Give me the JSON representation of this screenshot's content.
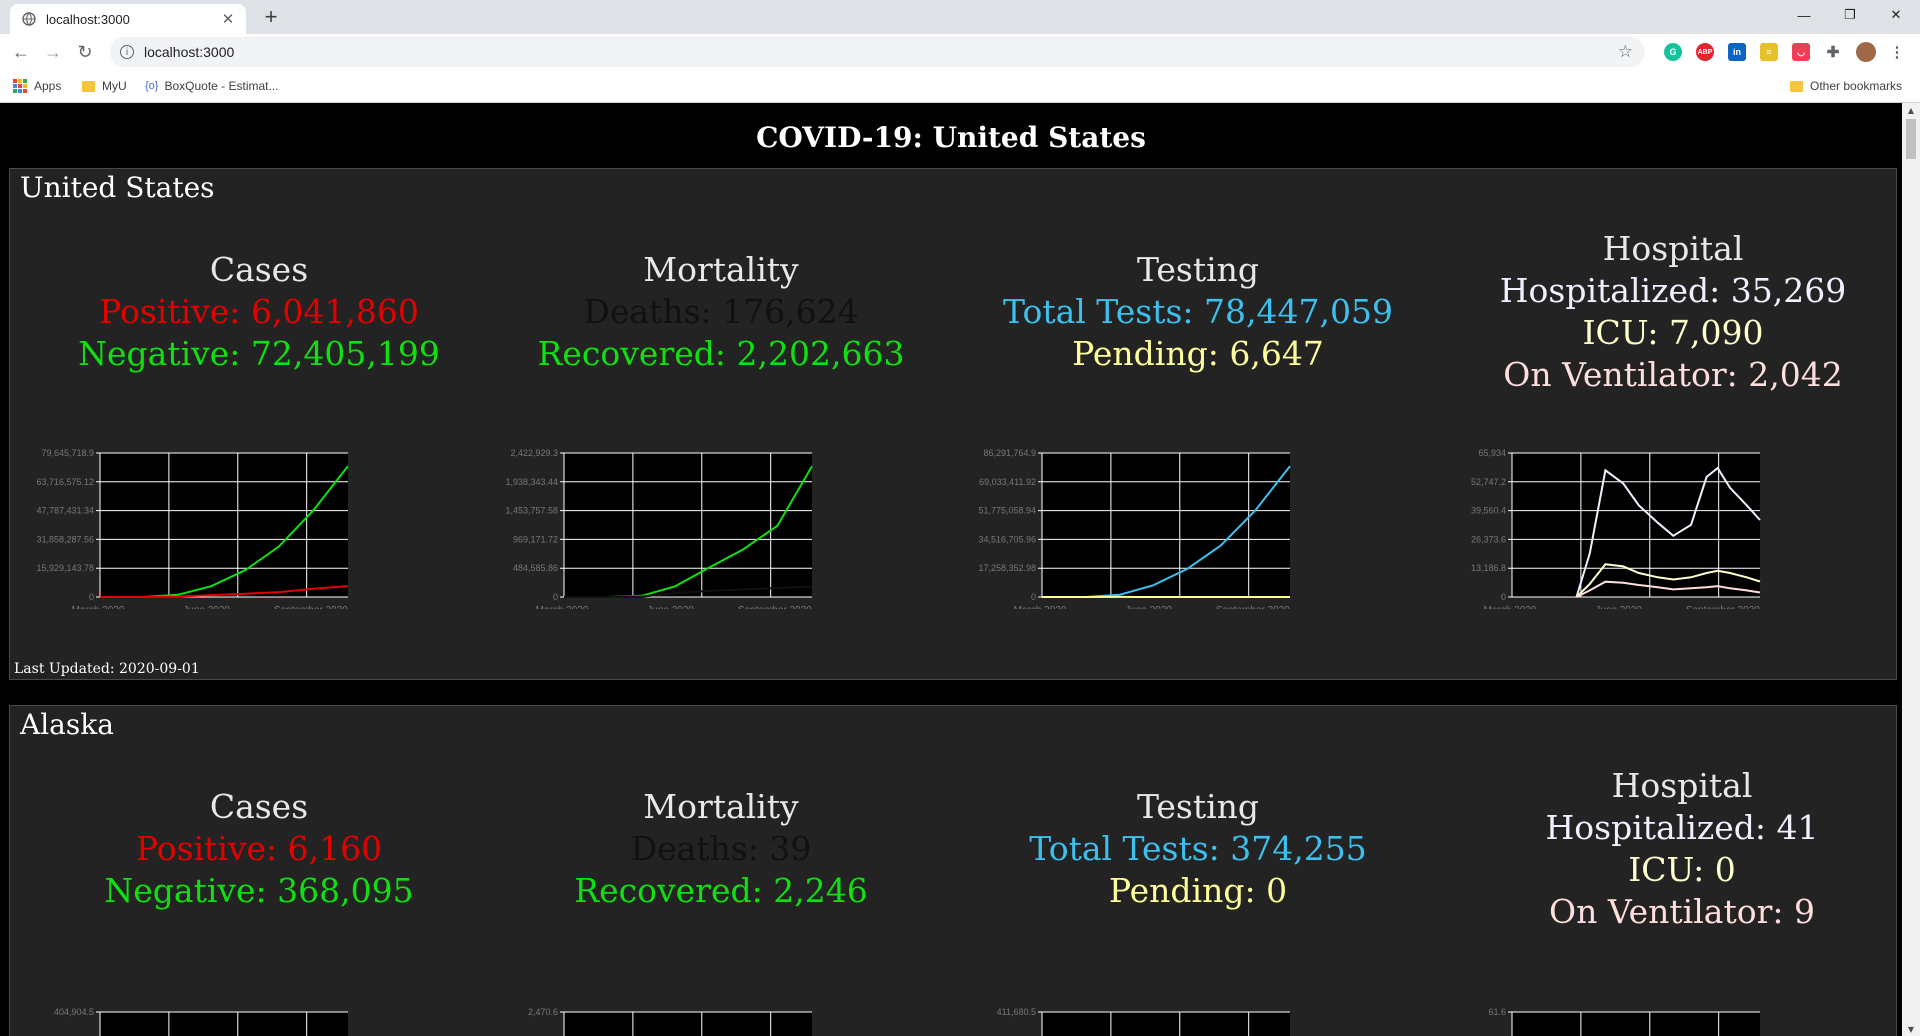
{
  "browser": {
    "tab_title": "localhost:3000",
    "url": "localhost:3000",
    "bookmarks": [
      {
        "label": "Apps",
        "icon": "apps-grid-icon"
      },
      {
        "label": "MyU",
        "icon": "folder-icon"
      },
      {
        "label": "BoxQuote - Estimat...",
        "icon": "boxquote-icon"
      }
    ],
    "other_bookmarks": "Other bookmarks",
    "extensions": [
      "grammarly-icon",
      "adblock-plus-icon",
      "linkedin-icon",
      "extension-icon",
      "pocket-icon",
      "puzzle-extensions-icon",
      "profile-avatar"
    ]
  },
  "page": {
    "title": "COVID-19: United States",
    "colors": {
      "positive": "#e50000",
      "negative": "#10e010",
      "deaths": "#111111",
      "tests": "#3cc0f0",
      "pending": "#ffff99",
      "hospital": "#f0f0ff",
      "icu": "#ffffcc",
      "ventilator": "#ffdede"
    }
  },
  "states": [
    {
      "name": "United States",
      "cases": {
        "head": "Cases",
        "positive_label": "Positive:",
        "positive": "6,041,860",
        "negative_label": "Negative:",
        "negative": "72,405,199"
      },
      "mortality": {
        "head": "Mortality",
        "deaths_label": "Deaths:",
        "deaths": "176,624",
        "recovered_label": "Recovered:",
        "recovered": "2,202,663"
      },
      "testing": {
        "head": "Testing",
        "total_label": "Total Tests:",
        "total": "78,447,059",
        "pending_label": "Pending:",
        "pending": "6,647"
      },
      "hospital": {
        "head": "Hospital",
        "hosp_label": "Hospitalized:",
        "hosp": "35,269",
        "icu_label": "ICU:",
        "icu": "7,090",
        "vent_label": "On Ventilator:",
        "vent": "2,042"
      },
      "last_updated": "Last Updated: 2020-09-01"
    },
    {
      "name": "Alaska",
      "cases": {
        "head": "Cases",
        "positive_label": "Positive:",
        "positive": "6,160",
        "negative_label": "Negative:",
        "negative": "368,095"
      },
      "mortality": {
        "head": "Mortality",
        "deaths_label": "Deaths:",
        "deaths": "39",
        "recovered_label": "Recovered:",
        "recovered": "2,246"
      },
      "testing": {
        "head": "Testing",
        "total_label": "Total Tests:",
        "total": "374,255",
        "pending_label": "Pending:",
        "pending": "0"
      },
      "hospital": {
        "head": "Hospital",
        "hosp_label": "Hospitalized:",
        "hosp": "41",
        "icu_label": "ICU:",
        "icu": "0",
        "vent_label": "On Ventilator:",
        "vent": "9"
      },
      "last_updated": ""
    }
  ],
  "chart_data": [
    {
      "type": "line",
      "panel": "United States - Cases",
      "xlabels": [
        "March 2020",
        "June 2020",
        "September 2020"
      ],
      "yticks": [
        "79,645,718.9",
        "63,716,575.12",
        "47,787,431.34",
        "31,858,287.56",
        "15,929,143.78",
        "0"
      ],
      "ylim": [
        0,
        79645718.9
      ],
      "x": [
        "2020-01-22",
        "2020-03-01",
        "2020-04-01",
        "2020-05-01",
        "2020-06-01",
        "2020-07-01",
        "2020-08-01",
        "2020-09-01"
      ],
      "series": [
        {
          "name": "Negative",
          "color": "#10e010",
          "values": [
            0,
            10000,
            1200000,
            6000000,
            15000000,
            28000000,
            48000000,
            72405199
          ]
        },
        {
          "name": "Positive",
          "color": "#e50000",
          "values": [
            0,
            100,
            200000,
            1070000,
            1800000,
            2700000,
            4600000,
            6041860
          ]
        }
      ]
    },
    {
      "type": "line",
      "panel": "United States - Mortality",
      "xlabels": [
        "March 2020",
        "June 2020",
        "September 2020"
      ],
      "yticks": [
        "2,422,929.3",
        "1,938,343.44",
        "1,453,757.58",
        "969,171.72",
        "484,585.86",
        "0"
      ],
      "ylim": [
        0,
        2422929.3
      ],
      "x": [
        "2020-01-22",
        "2020-03-01",
        "2020-04-01",
        "2020-05-01",
        "2020-06-01",
        "2020-07-01",
        "2020-08-01",
        "2020-09-01"
      ],
      "series": [
        {
          "name": "Recovered",
          "color": "#10e010",
          "values": [
            0,
            0,
            20000,
            180000,
            500000,
            800000,
            1200000,
            2202663
          ]
        },
        {
          "name": "Deaths",
          "color": "#111111",
          "values": [
            0,
            0,
            6000,
            62000,
            104000,
            127000,
            152000,
            176624
          ]
        }
      ]
    },
    {
      "type": "line",
      "panel": "United States - Testing",
      "xlabels": [
        "March 2020",
        "June 2020",
        "September 2020"
      ],
      "yticks": [
        "86,291,764.9",
        "69,033,411.92",
        "51,775,058.94",
        "34,516,705.96",
        "17,258,352.98",
        "0"
      ],
      "ylim": [
        0,
        86291764.9
      ],
      "x": [
        "2020-01-22",
        "2020-03-01",
        "2020-04-01",
        "2020-05-01",
        "2020-06-01",
        "2020-07-01",
        "2020-08-01",
        "2020-09-01"
      ],
      "series": [
        {
          "name": "Total Tests",
          "color": "#3cc0f0",
          "values": [
            0,
            10000,
            1400000,
            7000000,
            17000000,
            31000000,
            52000000,
            78447059
          ]
        },
        {
          "name": "Pending",
          "color": "#ffff99",
          "values": [
            0,
            0,
            60000,
            5000,
            3000,
            2000,
            8000,
            6647
          ]
        }
      ]
    },
    {
      "type": "line",
      "panel": "United States - Hospital",
      "xlabels": [
        "March 2020",
        "June 2020",
        "September 2020"
      ],
      "yticks": [
        "65,934",
        "52,747.2",
        "39,560.4",
        "26,373.6",
        "13,186.8",
        "0"
      ],
      "ylim": [
        0,
        65934
      ],
      "x": [
        "2020-03-20",
        "2020-04-01",
        "2020-04-15",
        "2020-05-01",
        "2020-05-15",
        "2020-06-01",
        "2020-06-15",
        "2020-07-01",
        "2020-07-15",
        "2020-07-25",
        "2020-08-05",
        "2020-08-20",
        "2020-09-01"
      ],
      "series": [
        {
          "name": "Hospitalized",
          "color": "#f0f0ff",
          "values": [
            0,
            20000,
            58000,
            52000,
            42000,
            34000,
            28000,
            33000,
            55000,
            59000,
            50000,
            42000,
            35269
          ]
        },
        {
          "name": "ICU",
          "color": "#ffffcc",
          "values": [
            0,
            6000,
            15000,
            14000,
            11000,
            9000,
            8000,
            9000,
            11000,
            12000,
            11000,
            9000,
            7090
          ]
        },
        {
          "name": "On Ventilator",
          "color": "#ffdede",
          "values": [
            0,
            3000,
            7000,
            6500,
            5500,
            4500,
            3500,
            4000,
            4500,
            5000,
            4000,
            3000,
            2042
          ]
        }
      ]
    },
    {
      "type": "line",
      "panel": "Alaska - Cases",
      "yticks": [
        "404,904.5"
      ],
      "partially_visible": true
    },
    {
      "type": "line",
      "panel": "Alaska - Mortality",
      "yticks": [
        "2,470.6"
      ],
      "partially_visible": true
    },
    {
      "type": "line",
      "panel": "Alaska - Testing",
      "yticks": [
        "411,680.5"
      ],
      "partially_visible": true
    },
    {
      "type": "line",
      "panel": "Alaska - Hospital",
      "yticks": [
        "61.6"
      ],
      "partially_visible": true
    }
  ]
}
